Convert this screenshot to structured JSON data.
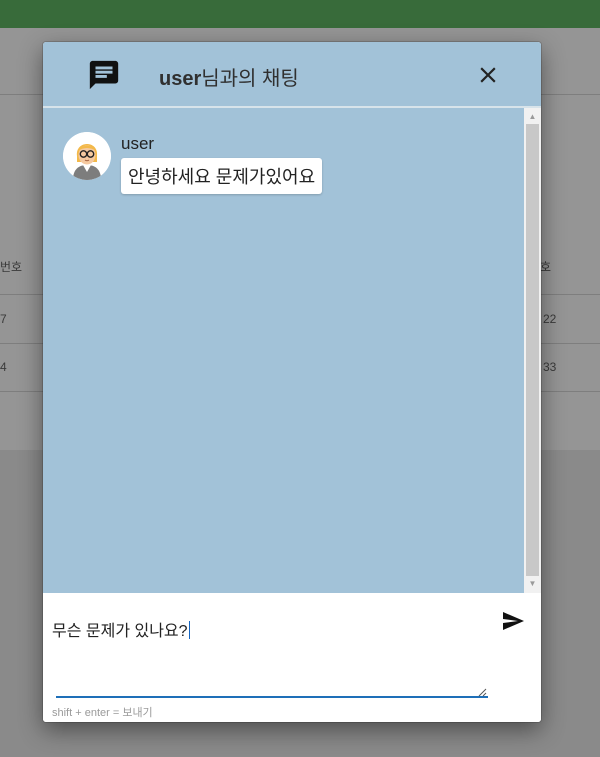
{
  "background": {
    "col_left_header": "번호",
    "col_right_header": "호",
    "rows": [
      {
        "left": "7",
        "right": "22"
      },
      {
        "left": "4",
        "right": "33"
      }
    ]
  },
  "dialog": {
    "title_user": "user",
    "title_suffix": "님과의 채팅",
    "header_color": "#a2c2d8",
    "icons": [
      "chat-icon",
      "close-icon",
      "send-icon"
    ]
  },
  "messages": [
    {
      "user": "user",
      "text": "안녕하세요 문제가있어요"
    }
  ],
  "composer": {
    "value": "무슨 문제가 있나요?",
    "hint": "shift + enter = 보내기"
  }
}
